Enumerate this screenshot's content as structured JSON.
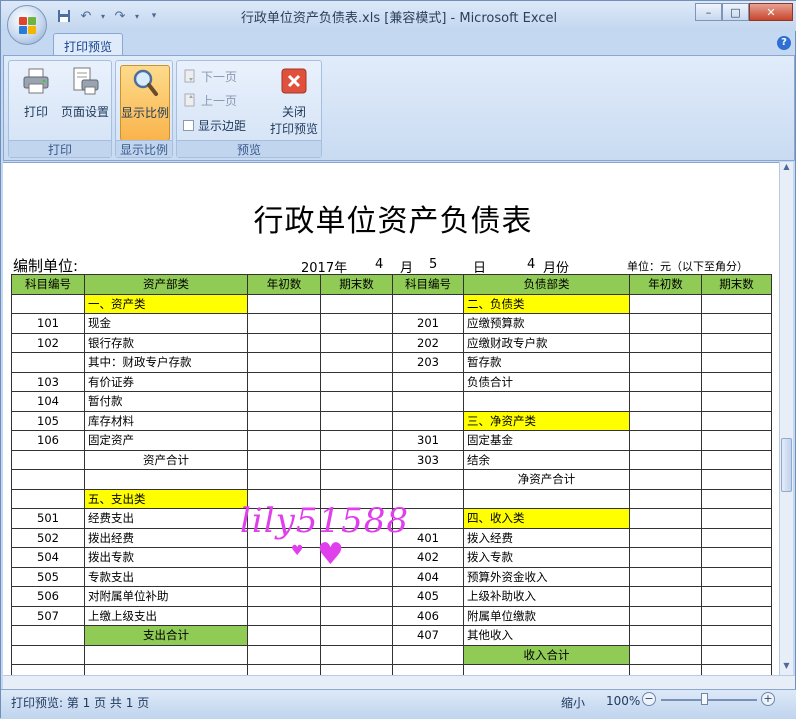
{
  "window": {
    "title": "行政单位资产负债表.xls  [兼容模式] - Microsoft Excel",
    "minimize": "–",
    "maximize": "□",
    "close": "✕"
  },
  "ribbon": {
    "tab": "打印预览",
    "help": "?",
    "groups": {
      "print": {
        "label": "打印",
        "print_btn": "打印",
        "page_setup_btn": "页面设置"
      },
      "zoom": {
        "label": "显示比例",
        "zoom_btn": "显示比例"
      },
      "preview": {
        "label": "预览",
        "next_page": "下一页",
        "prev_page": "上一页",
        "show_margins": "显示边距",
        "close_line1": "关闭",
        "close_line2": "打印预览"
      }
    }
  },
  "sheet": {
    "title": "行政单位资产负债表",
    "meta": {
      "unit_label": "编制单位:",
      "year": "2017年",
      "month_num": "4",
      "month": "月",
      "day_num": "5",
      "day": "日",
      "period_num": "4",
      "period": "月份",
      "currency": "单位：元（以下至角分）"
    },
    "headers": [
      "科目编号",
      "资产部类",
      "年初数",
      "期末数",
      "科目编号",
      "负债部类",
      "年初数",
      "期末数"
    ],
    "rows": [
      [
        "",
        "一、资产类",
        "",
        "",
        "",
        "二、负债类",
        "",
        ""
      ],
      [
        "101",
        "现金",
        "",
        "",
        "201",
        "应缴预算款",
        "",
        ""
      ],
      [
        "102",
        "银行存款",
        "",
        "",
        "202",
        "应缴财政专户款",
        "",
        ""
      ],
      [
        "",
        "其中：财政专户存款",
        "",
        "",
        "203",
        "暂存款",
        "",
        ""
      ],
      [
        "103",
        "有价证券",
        "",
        "",
        "",
        "负债合计",
        "",
        ""
      ],
      [
        "104",
        "暂付款",
        "",
        "",
        "",
        "",
        "",
        ""
      ],
      [
        "105",
        "库存材料",
        "",
        "",
        "",
        "三、净资产类",
        "",
        ""
      ],
      [
        "106",
        "固定资产",
        "",
        "",
        "301",
        "固定基金",
        "",
        ""
      ],
      [
        "",
        "资产合计",
        "",
        "",
        "303",
        "结余",
        "",
        ""
      ],
      [
        "",
        "",
        "",
        "",
        "",
        "净资产合计",
        "",
        ""
      ],
      [
        "",
        "五、支出类",
        "",
        "",
        "",
        "",
        "",
        ""
      ],
      [
        "501",
        "经费支出",
        "",
        "",
        "",
        "四、收入类",
        "",
        ""
      ],
      [
        "502",
        "拨出经费",
        "",
        "",
        "401",
        "拨入经费",
        "",
        ""
      ],
      [
        "504",
        "拨出专款",
        "",
        "",
        "402",
        "拨入专款",
        "",
        ""
      ],
      [
        "505",
        "专款支出",
        "",
        "",
        "404",
        "预算外资金收入",
        "",
        ""
      ],
      [
        "506",
        "对附属单位补助",
        "",
        "",
        "405",
        "上级补助收入",
        "",
        ""
      ],
      [
        "507",
        "上缴上级支出",
        "",
        "",
        "406",
        "附属单位缴款",
        "",
        ""
      ],
      [
        "",
        "支出合计",
        "",
        "",
        "407",
        "其他收入",
        "",
        ""
      ],
      [
        "",
        "",
        "",
        "",
        "",
        "收入合计",
        "",
        ""
      ],
      [
        "",
        "",
        "",
        "",
        "",
        "",
        "",
        ""
      ]
    ],
    "watermark": "lily51588"
  },
  "status": {
    "text": "打印预览: 第 1 页 共 1 页",
    "zoom_label": "缩小",
    "zoom_pct": "100%",
    "zoom_minus": "−",
    "zoom_plus": "+"
  }
}
